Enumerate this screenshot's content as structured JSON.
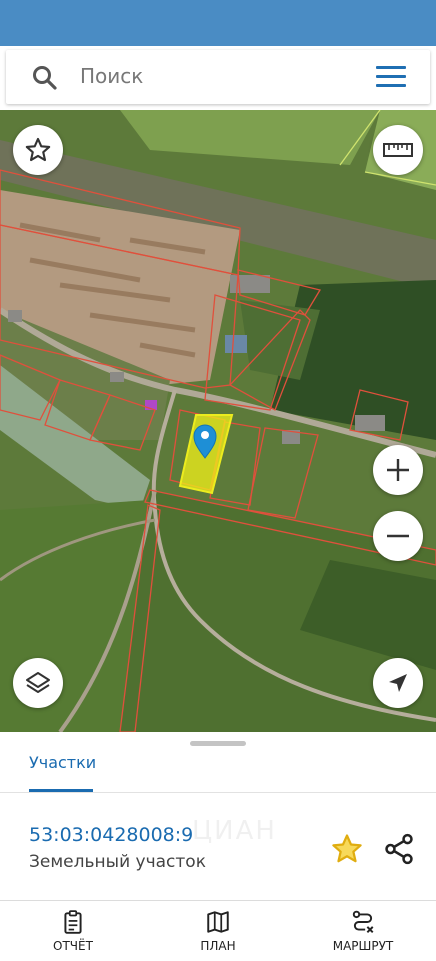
{
  "search": {
    "placeholder": "Поиск",
    "search_icon": "search-icon",
    "menu_icon": "menu-icon"
  },
  "map": {
    "buttons": {
      "favorites": "star-outline-icon",
      "ruler": "ruler-icon",
      "zoom_in": "plus-icon",
      "zoom_out": "minus-icon",
      "layers": "layers-icon",
      "locate": "navigation-arrow-icon"
    },
    "colors": {
      "selected_parcel": "#f2f21a",
      "parcel_border": "#e0503c",
      "pin": "#1e8fd6"
    }
  },
  "panel": {
    "tab_label": "Участки",
    "cadastral_number": "53:03:0428008:9",
    "parcel_type": "Земельный участок",
    "watermark": "ЦИАН",
    "accent_color": "#1a6bb0",
    "star_color": "#f3c31c"
  },
  "bottom_nav": {
    "items": [
      {
        "label": "ОТЧЁТ",
        "icon": "report-icon"
      },
      {
        "label": "ПЛАН",
        "icon": "map-plan-icon"
      },
      {
        "label": "МАРШРУТ",
        "icon": "route-icon"
      }
    ]
  }
}
